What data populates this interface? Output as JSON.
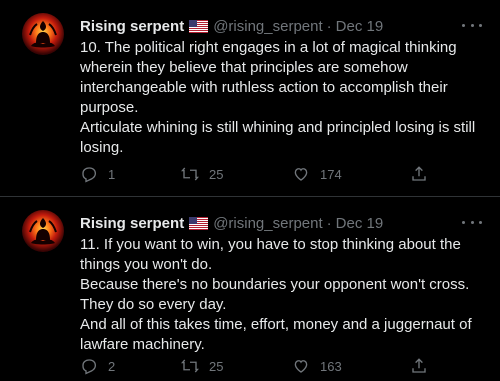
{
  "tweets": [
    {
      "name": "Rising serpent",
      "handle": "@rising_serpent",
      "separator": "·",
      "date": "Dec 19",
      "lines": [
        "10. The political right engages in a lot of magical thinking",
        "wherein they believe that principles are somehow",
        "interchangeable with ruthless action to accomplish their",
        "purpose.",
        "Articulate whining is still whining and principled losing is still",
        "losing."
      ],
      "replies": "1",
      "retweets": "25",
      "likes": "174"
    },
    {
      "name": "Rising serpent",
      "handle": "@rising_serpent",
      "separator": "·",
      "date": "Dec 19",
      "lines": [
        "11. If you want to win, you have to stop thinking about the",
        "things you won't do.",
        "Because there's no boundaries your opponent won't cross.",
        "They do so every day.",
        "And all of this takes time, effort, money and a juggernaut of",
        "lawfare machinery."
      ],
      "replies": "2",
      "retweets": "25",
      "likes": "163"
    }
  ],
  "icons": {
    "reply": "reply-icon",
    "retweet": "retweet-icon",
    "like": "heart-icon",
    "share": "share-icon",
    "more": "more-icon",
    "flag": "us-flag-icon"
  },
  "colors": {
    "background": "#000000",
    "text": "#e7e9ea",
    "muted": "#71767b",
    "divider": "#2f3336"
  }
}
